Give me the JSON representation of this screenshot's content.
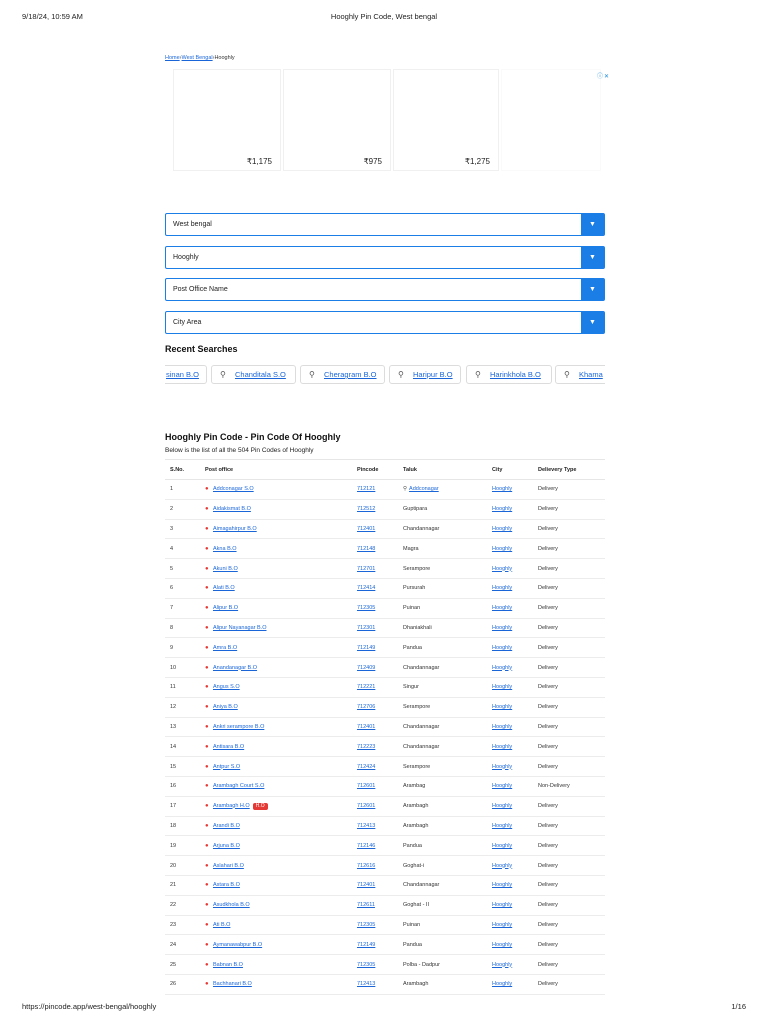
{
  "print_header": {
    "datetime": "9/18/24, 10:59 AM",
    "title": "Hooghly Pin Code, West bengal"
  },
  "print_footer": {
    "url": "https://pincode.app/west-bengal/hooghly",
    "page": "1/16"
  },
  "breadcrumb": {
    "home": "Home",
    "sep1": "›",
    "state": "West Bengal",
    "sep2": "›",
    "current": "Hooghly"
  },
  "ads": {
    "prices": [
      "₹1,175",
      "₹975",
      "₹1,275"
    ]
  },
  "selects": [
    {
      "value": "West bengal"
    },
    {
      "value": "Hooghly"
    },
    {
      "value": "Post Office Name"
    },
    {
      "value": "City Area"
    }
  ],
  "recent": {
    "title": "Recent Searches",
    "items": [
      "sinan B.O",
      "Chanditala S.O",
      "Cheragram B.O",
      "Haripur B.O",
      "Harinkhola B.O",
      "Khama"
    ]
  },
  "section": {
    "title": "Hooghly Pin Code - Pin Code Of Hooghly",
    "subtitle": "Below is the list of all the 504 Pin Codes of Hooghly"
  },
  "table": {
    "headers": [
      "S.No.",
      "Post office",
      "Pincode",
      "Taluk",
      "City",
      "Delievery Type"
    ],
    "rows": [
      {
        "sno": "1",
        "office": "Addconagar S.O",
        "pincode": "712121",
        "taluk": "Addconagar",
        "city": "Hooghly",
        "type": "Delivery"
      },
      {
        "sno": "2",
        "office": "Aidakismat B.O",
        "pincode": "712512",
        "taluk": "Guptipara",
        "city": "Hooghly",
        "type": "Delivery"
      },
      {
        "sno": "3",
        "office": "Aimagahirpur B.O",
        "pincode": "712401",
        "taluk": "Chandannagar",
        "city": "Hooghly",
        "type": "Delivery"
      },
      {
        "sno": "4",
        "office": "Akna B.O",
        "pincode": "712148",
        "taluk": "Magra",
        "city": "Hooghly",
        "type": "Delivery"
      },
      {
        "sno": "5",
        "office": "Akuni B.O",
        "pincode": "712701",
        "taluk": "Serampore",
        "city": "Hooghly",
        "type": "Delivery"
      },
      {
        "sno": "6",
        "office": "Alati B.O",
        "pincode": "712414",
        "taluk": "Pursurah",
        "city": "Hooghly",
        "type": "Delivery"
      },
      {
        "sno": "7",
        "office": "Alipur B.O",
        "pincode": "712305",
        "taluk": "Puinan",
        "city": "Hooghly",
        "type": "Delivery"
      },
      {
        "sno": "8",
        "office": "Alipur Nayanagar B.O",
        "pincode": "712301",
        "taluk": "Dhaniakhali",
        "city": "Hooghly",
        "type": "Delivery"
      },
      {
        "sno": "9",
        "office": "Amra B.O",
        "pincode": "712149",
        "taluk": "Pandua",
        "city": "Hooghly",
        "type": "Delivery"
      },
      {
        "sno": "10",
        "office": "Anandanagar B.O",
        "pincode": "712409",
        "taluk": "Chandannagar",
        "city": "Hooghly",
        "type": "Delivery"
      },
      {
        "sno": "11",
        "office": "Angus S.O",
        "pincode": "712221",
        "taluk": "Singur",
        "city": "Hooghly",
        "type": "Delivery"
      },
      {
        "sno": "12",
        "office": "Aniya B.O",
        "pincode": "712706",
        "taluk": "Serampore",
        "city": "Hooghly",
        "type": "Delivery"
      },
      {
        "sno": "13",
        "office": "Ankri serampore B.O",
        "pincode": "712401",
        "taluk": "Chandannagar",
        "city": "Hooghly",
        "type": "Delivery"
      },
      {
        "sno": "14",
        "office": "Antisara B.O",
        "pincode": "712223",
        "taluk": "Chandannagar",
        "city": "Hooghly",
        "type": "Delivery"
      },
      {
        "sno": "15",
        "office": "Antpur S.O",
        "pincode": "712424",
        "taluk": "Serampore",
        "city": "Hooghly",
        "type": "Delivery"
      },
      {
        "sno": "16",
        "office": "Arambagh Court S.O",
        "pincode": "712601",
        "taluk": "Arambag",
        "city": "Hooghly",
        "type": "Non-Delivery"
      },
      {
        "sno": "17",
        "office": "Arambagh H.O",
        "badge": "H.O",
        "pincode": "712601",
        "taluk": "Arambagh",
        "city": "Hooghly",
        "type": "Delivery"
      },
      {
        "sno": "18",
        "office": "Arandi B.O",
        "pincode": "712413",
        "taluk": "Arambagh",
        "city": "Hooghly",
        "type": "Delivery"
      },
      {
        "sno": "19",
        "office": "Arjuna B.O",
        "pincode": "712146",
        "taluk": "Pandua",
        "city": "Hooghly",
        "type": "Delivery"
      },
      {
        "sno": "20",
        "office": "Aslahari B.O",
        "pincode": "712616",
        "taluk": "Goghat-i",
        "city": "Hooghly",
        "type": "Delivery"
      },
      {
        "sno": "21",
        "office": "Astara B.O",
        "pincode": "712401",
        "taluk": "Chandannagar",
        "city": "Hooghly",
        "type": "Delivery"
      },
      {
        "sno": "22",
        "office": "Asudkhola B.O",
        "pincode": "712611",
        "taluk": "Goghat - II",
        "city": "Hooghly",
        "type": "Delivery"
      },
      {
        "sno": "23",
        "office": "Ati B.O",
        "pincode": "712305",
        "taluk": "Puinan",
        "city": "Hooghly",
        "type": "Delivery"
      },
      {
        "sno": "24",
        "office": "Aymanawabpur B.O",
        "pincode": "712149",
        "taluk": "Pandua",
        "city": "Hooghly",
        "type": "Delivery"
      },
      {
        "sno": "25",
        "office": "Babnan B.O",
        "pincode": "712305",
        "taluk": "Polba - Dadpur",
        "city": "Hooghly",
        "type": "Delivery"
      },
      {
        "sno": "26",
        "office": "Bachhanari B.O",
        "pincode": "712413",
        "taluk": "Arambagh",
        "city": "Hooghly",
        "type": "Delivery"
      }
    ]
  }
}
